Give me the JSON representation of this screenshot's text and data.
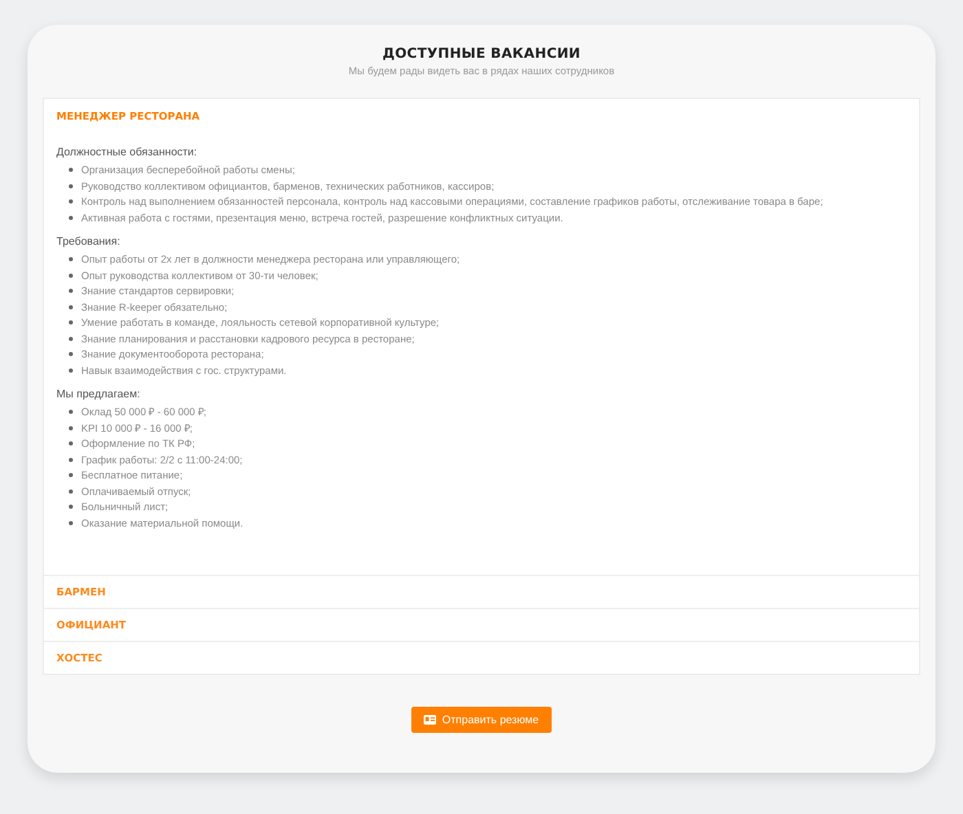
{
  "header": {
    "title": "ДОСТУПНЫЕ ВАКАНСИИ",
    "subtitle": "Мы будем рады видеть вас в рядах наших сотрудников"
  },
  "vacancies": [
    {
      "title": "МЕНЕДЖЕР РЕСТОРАНА",
      "expanded": true,
      "sections": [
        {
          "heading": "Должностные обязанности:",
          "items": [
            "Организация бесперебойной работы смены;",
            "Руководство коллективом официантов, барменов, технических работников, кассиров;",
            "Контроль над выполнением обязанностей персонала, контроль над кассовыми операциями, составление графиков работы, отслеживание товара в баре;",
            "Активная работа с гостями, презентация меню, встреча гостей, разрешение конфликтных ситуации."
          ]
        },
        {
          "heading": "Требования:",
          "items": [
            "Опыт работы от 2х лет в должности менеджера ресторана или управляющего;",
            "Опыт руководства коллективом от 30-ти человек;",
            "Знание стандартов сервировки;",
            "Знание R-keeper обязательно;",
            "Умение работать в команде, лояльность сетевой корпоративной культуре;",
            "Знание планирования и расстановки кадрового ресурса в ресторане;",
            "Знание документооборота ресторана;",
            "Навык взаимодействия с гос. структурами."
          ]
        },
        {
          "heading": "Мы предлагаем:",
          "items": [
            "Оклад 50 000 ₽ - 60 000 ₽;",
            "KPI 10 000 ₽ - 16 000 ₽;",
            "Оформление по ТК РФ;",
            "График работы: 2/2 с 11:00-24:00;",
            "Бесплатное питание;",
            "Оплачиваемый отпуск;",
            "Больничный лист;",
            "Оказание материальной помощи."
          ]
        }
      ]
    },
    {
      "title": "БАРМЕН",
      "expanded": false
    },
    {
      "title": "ОФИЦИАНТ",
      "expanded": false
    },
    {
      "title": "ХОСТЕС",
      "expanded": false
    }
  ],
  "submit_button": "Отправить резюме"
}
